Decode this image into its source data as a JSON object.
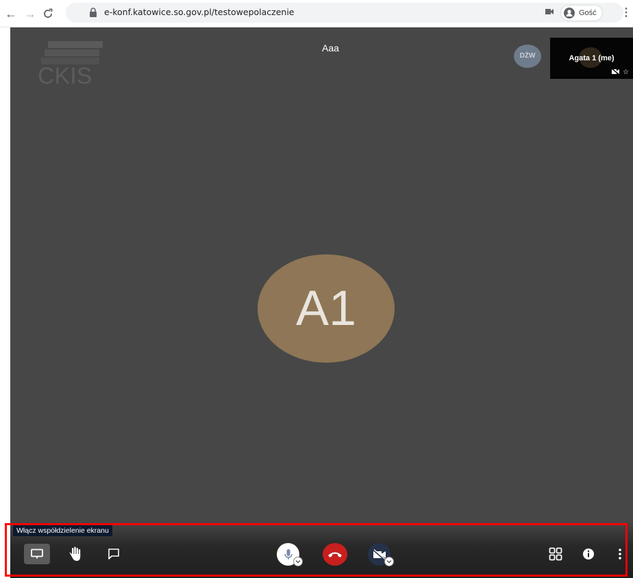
{
  "browser": {
    "url": "e-konf.katowice.so.gov.pl/testowepolaczenie",
    "profile_label": "Gość",
    "back_icon": "arrow-left-icon",
    "forward_icon": "arrow-right-icon",
    "reload_icon": "reload-icon",
    "lock_icon": "lock-icon",
    "camera_icon": "camera-icon",
    "menu_icon": "kebab-menu-icon"
  },
  "conference": {
    "logo_text": "CKIS",
    "meeting_title": "Aaa",
    "participants": [
      {
        "initials": "DŻW",
        "color": "#6f7c8c"
      }
    ],
    "self_view": {
      "name": "Agata 1 (me)",
      "video_muted": true
    },
    "dominant_speaker": {
      "initials": "A1",
      "avatar_color": "#8e7656"
    }
  },
  "toolbar": {
    "tooltip": "Włącz współdzielenie ekranu",
    "buttons": {
      "screen_share": "screen-share-icon",
      "raise_hand": "raise-hand-icon",
      "chat": "chat-icon",
      "microphone": "microphone-icon",
      "hangup": "hangup-icon",
      "camera": "camera-off-icon",
      "tile_view": "tile-view-icon",
      "info": "info-icon",
      "more": "more-vertical-icon"
    }
  },
  "colors": {
    "stage_background": "#474747",
    "hangup": "#c81f1f",
    "highlight": "#ff0000"
  }
}
